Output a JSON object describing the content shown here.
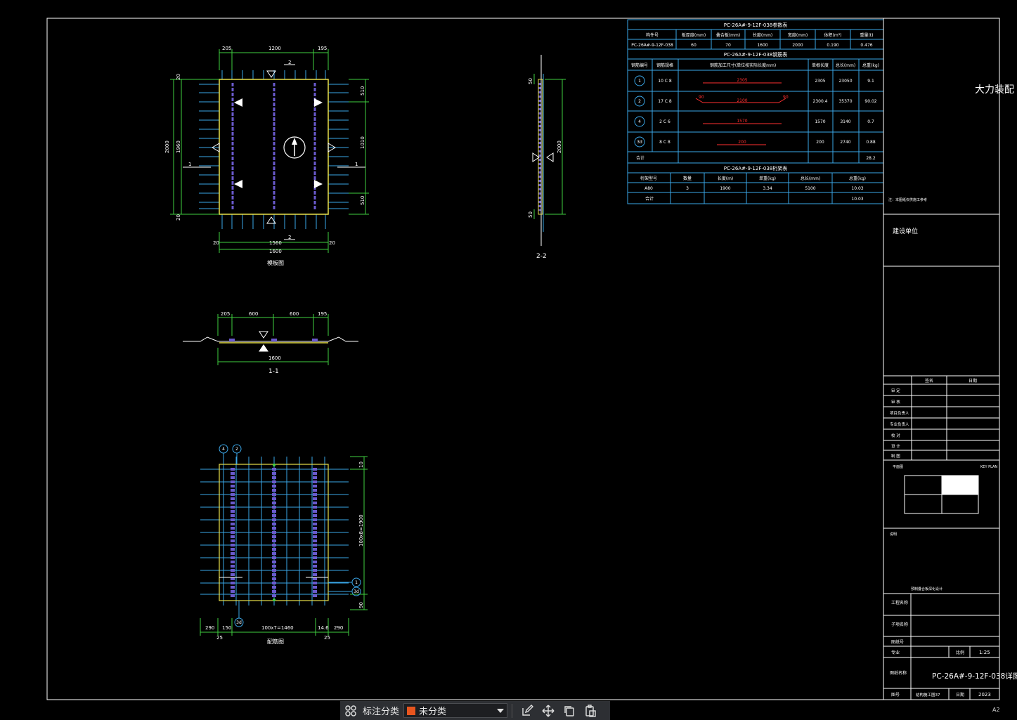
{
  "drawing": {
    "top_plan": {
      "dims_top": [
        "205",
        "1200",
        "195"
      ],
      "dims_bottom": [
        "20",
        "1560",
        "1600",
        "20"
      ],
      "dims_left": [
        "2000",
        "1960",
        "20",
        "20"
      ],
      "dims_right": [
        "510",
        "1010",
        "510"
      ],
      "section_marks": [
        "2",
        "2",
        "1",
        "1"
      ],
      "caption": "模板图"
    },
    "section_1": {
      "dims_top": [
        "205",
        "600",
        "600",
        "195"
      ],
      "dims_bottom": [
        "1600"
      ],
      "caption": "1-1"
    },
    "section_2": {
      "dims_right": [
        "2000"
      ],
      "dims_left": [
        "50",
        "50"
      ],
      "caption": "2-2"
    },
    "rebar_plan": {
      "circle_marks": [
        "4",
        "2",
        "1",
        "3d",
        "3d"
      ],
      "dims_bottom": [
        "290",
        "150",
        "100x7=1460",
        "14.6",
        "290"
      ],
      "dims_bottom_sub": [
        "25",
        "25"
      ],
      "dims_right": [
        "10",
        "100x8=1900",
        "90"
      ],
      "caption": "配筋图"
    }
  },
  "tables": {
    "t1": {
      "title": "PC-26A#-9-12F-038参数表",
      "headers": [
        "构件号",
        "板厚度(mm)",
        "叠合板(mm)",
        "长度(mm)",
        "宽度(mm)",
        "体积(m³)",
        "重量(t)"
      ],
      "row": [
        "PC-26A#-9-12F-038",
        "60",
        "70",
        "1600",
        "2000",
        "0.190",
        "0.476"
      ]
    },
    "t2": {
      "title": "PC-26A#-9-12F-038钢筋表",
      "headers": [
        "钢筋编号",
        "钢筋规格",
        "钢筋加工尺寸(单位按实际长度mm)",
        "单根长度",
        "总长(mm)",
        "总重(kg)"
      ],
      "rows": [
        {
          "no": "1",
          "spec": "10 C 8",
          "len_label": "2305",
          "single": "2305",
          "total": "23050",
          "weight": "9.1"
        },
        {
          "no": "2",
          "spec": "17 C 8",
          "len_label": "2100",
          "single": "2300.4",
          "total": "35370",
          "weight": "90.02"
        },
        {
          "no": "4",
          "spec": "2 C 6",
          "len_label": "1570",
          "single": "1570",
          "total": "3140",
          "weight": "0.7"
        },
        {
          "no": "3d",
          "spec": "8 C 8",
          "len_label": "200",
          "single": "200",
          "total": "2740",
          "weight": "0.88"
        }
      ],
      "hook_left": "90",
      "hook_right": "90",
      "total_label": "合计",
      "total_value": "28.2"
    },
    "t3": {
      "title": "PC-26A#-9-12F-038桁架表",
      "headers": [
        "桁架型号",
        "数量",
        "长度(m)",
        "单重(kg)",
        "总长(mm)",
        "总重(kg)"
      ],
      "row": [
        "A80",
        "3",
        "1900",
        "3.34",
        "5100",
        "10.03"
      ],
      "total_label": "合计",
      "total_value": "10.03"
    }
  },
  "title_block": {
    "project_name": "大力装配",
    "note": "注：本图纸仅供施工参考",
    "build_unit": "建设单位",
    "sign_headers": [
      "签名",
      "日期"
    ],
    "sign_rows": [
      "审  定",
      "审  核",
      "项目负责人",
      "专业负责人",
      "校  对",
      "设  计",
      "制  图"
    ],
    "key_plan_label": "平面图",
    "key_plan_note": "KEY PLAN",
    "section_label": "说明",
    "section_caption": "预制叠合板深化设计",
    "rows": [
      "工程名称",
      "子项名称",
      "图纸号"
    ],
    "scale_label": "专业",
    "scale_key": "比例",
    "scale_value": "1:25",
    "drawing_title_label": "图纸名称",
    "drawing_title": "PC-26A#-9-12F-038详图",
    "bottom_row": [
      "图号",
      "结构施工图37",
      "日期",
      "2023"
    ]
  },
  "toolbar": {
    "label": "标注分类",
    "selected": "未分类",
    "accent": "#e8551e"
  },
  "corner_label": "A2"
}
